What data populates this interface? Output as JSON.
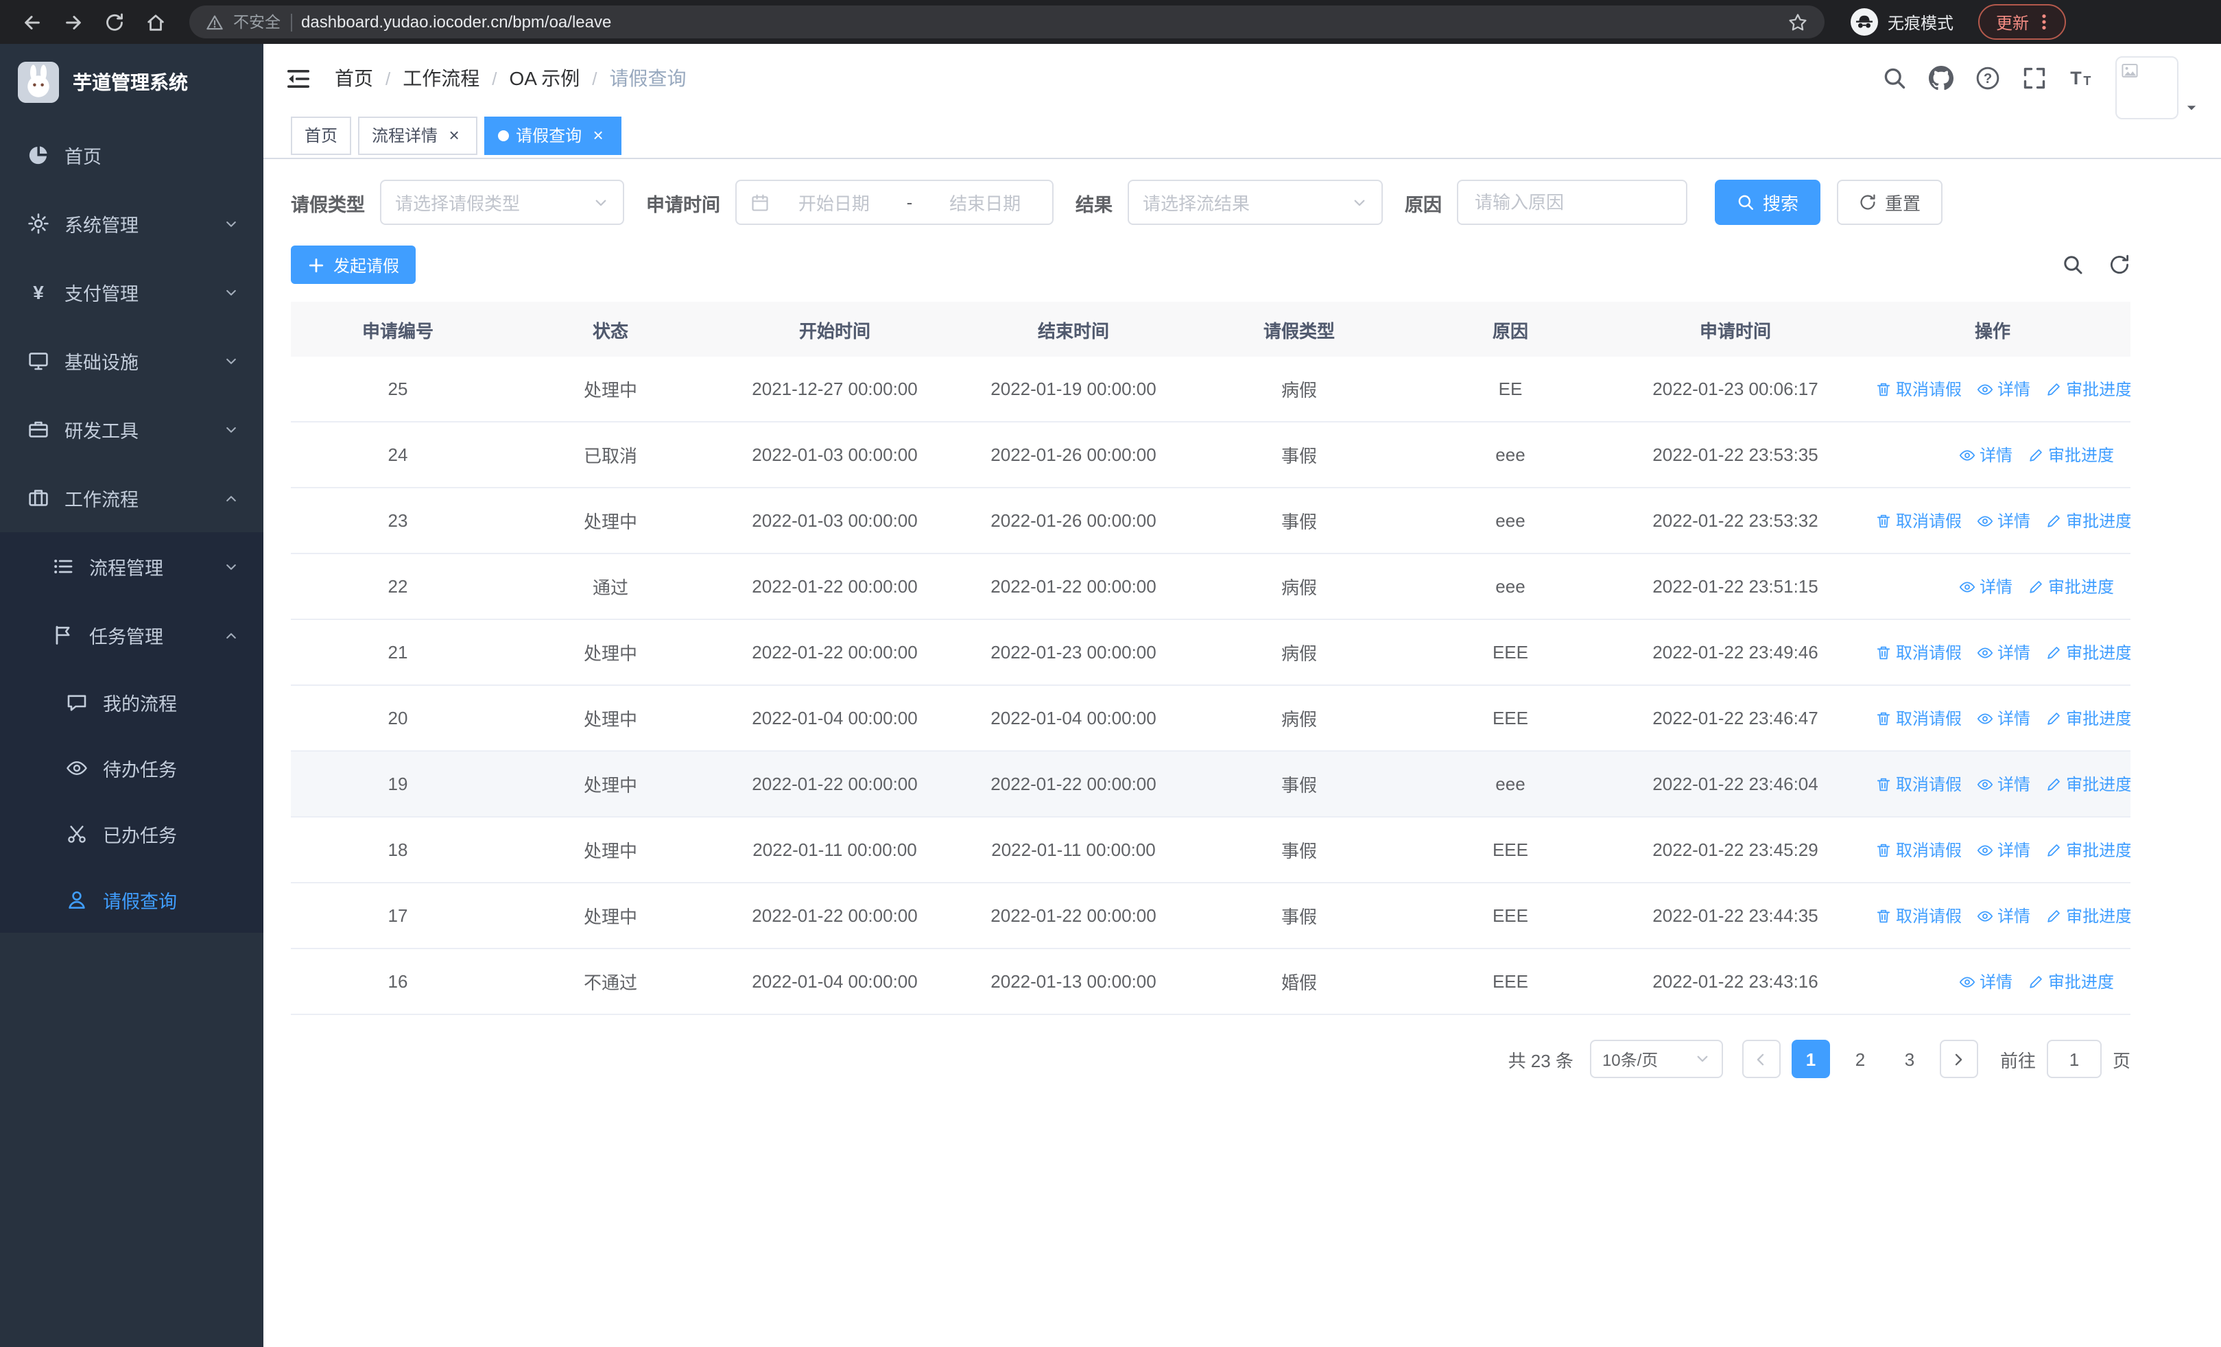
{
  "browser": {
    "security_warning": "不安全",
    "url": "dashboard.yudao.iocoder.cn/bpm/oa/leave",
    "incognito_label": "无痕模式",
    "update_label": "更新"
  },
  "sidebar": {
    "title": "芋道管理系统",
    "items": [
      {
        "key": "home",
        "label": "首页",
        "icon": "pie",
        "level": 1
      },
      {
        "key": "system",
        "label": "系统管理",
        "icon": "gear",
        "level": 1,
        "chevron": "down"
      },
      {
        "key": "payment",
        "label": "支付管理",
        "icon": "yen",
        "level": 1,
        "chevron": "down"
      },
      {
        "key": "infra",
        "label": "基础设施",
        "icon": "monitor",
        "level": 1,
        "chevron": "down"
      },
      {
        "key": "devtools",
        "label": "研发工具",
        "icon": "briefcase",
        "level": 1,
        "chevron": "down"
      },
      {
        "key": "workflow",
        "label": "工作流程",
        "icon": "suitcase",
        "level": 1,
        "chevron": "up"
      },
      {
        "key": "process",
        "label": "流程管理",
        "icon": "list",
        "level": 2,
        "chevron": "down"
      },
      {
        "key": "task",
        "label": "任务管理",
        "icon": "flag",
        "level": 2,
        "chevron": "up"
      },
      {
        "key": "my-process",
        "label": "我的流程",
        "icon": "chat",
        "level": 3
      },
      {
        "key": "todo",
        "label": "待办任务",
        "icon": "eye",
        "level": 3
      },
      {
        "key": "done",
        "label": "已办任务",
        "icon": "scissors",
        "level": 3
      },
      {
        "key": "leave",
        "label": "请假查询",
        "icon": "user",
        "level": 3,
        "active": true
      }
    ]
  },
  "header": {
    "breadcrumb": [
      "首页",
      "工作流程",
      "OA 示例",
      "请假查询"
    ]
  },
  "tabs": [
    {
      "label": "首页",
      "closable": false,
      "active": false
    },
    {
      "label": "流程详情",
      "closable": true,
      "active": false
    },
    {
      "label": "请假查询",
      "closable": true,
      "active": true
    }
  ],
  "filters": {
    "leave_type": {
      "label": "请假类型",
      "placeholder": "请选择请假类型"
    },
    "apply_time": {
      "label": "申请时间",
      "start_placeholder": "开始日期",
      "separator": "-",
      "end_placeholder": "结束日期"
    },
    "result": {
      "label": "结果",
      "placeholder": "请选择流结果"
    },
    "reason": {
      "label": "原因",
      "placeholder": "请输入原因"
    },
    "search_label": "搜索",
    "reset_label": "重置"
  },
  "toolbar": {
    "create_label": "发起请假"
  },
  "table": {
    "columns": [
      "申请编号",
      "状态",
      "开始时间",
      "结束时间",
      "请假类型",
      "原因",
      "申请时间",
      "操作"
    ],
    "action_labels": {
      "cancel": "取消请假",
      "detail": "详情",
      "progress": "审批进度"
    },
    "rows": [
      {
        "id": "25",
        "status": "处理中",
        "start": "2021-12-27 00:00:00",
        "end": "2022-01-19 00:00:00",
        "type": "病假",
        "reason": "EE",
        "applied": "2022-01-23 00:06:17",
        "actions": [
          "cancel",
          "detail",
          "progress"
        ]
      },
      {
        "id": "24",
        "status": "已取消",
        "start": "2022-01-03 00:00:00",
        "end": "2022-01-26 00:00:00",
        "type": "事假",
        "reason": "eee",
        "applied": "2022-01-22 23:53:35",
        "actions": [
          "detail",
          "progress"
        ]
      },
      {
        "id": "23",
        "status": "处理中",
        "start": "2022-01-03 00:00:00",
        "end": "2022-01-26 00:00:00",
        "type": "事假",
        "reason": "eee",
        "applied": "2022-01-22 23:53:32",
        "actions": [
          "cancel",
          "detail",
          "progress"
        ]
      },
      {
        "id": "22",
        "status": "通过",
        "start": "2022-01-22 00:00:00",
        "end": "2022-01-22 00:00:00",
        "type": "病假",
        "reason": "eee",
        "applied": "2022-01-22 23:51:15",
        "actions": [
          "detail",
          "progress"
        ]
      },
      {
        "id": "21",
        "status": "处理中",
        "start": "2022-01-22 00:00:00",
        "end": "2022-01-23 00:00:00",
        "type": "病假",
        "reason": "EEE",
        "applied": "2022-01-22 23:49:46",
        "actions": [
          "cancel",
          "detail",
          "progress"
        ]
      },
      {
        "id": "20",
        "status": "处理中",
        "start": "2022-01-04 00:00:00",
        "end": "2022-01-04 00:00:00",
        "type": "病假",
        "reason": "EEE",
        "applied": "2022-01-22 23:46:47",
        "actions": [
          "cancel",
          "detail",
          "progress"
        ]
      },
      {
        "id": "19",
        "status": "处理中",
        "start": "2022-01-22 00:00:00",
        "end": "2022-01-22 00:00:00",
        "type": "事假",
        "reason": "eee",
        "applied": "2022-01-22 23:46:04",
        "actions": [
          "cancel",
          "detail",
          "progress"
        ],
        "hovered": true
      },
      {
        "id": "18",
        "status": "处理中",
        "start": "2022-01-11 00:00:00",
        "end": "2022-01-11 00:00:00",
        "type": "事假",
        "reason": "EEE",
        "applied": "2022-01-22 23:45:29",
        "actions": [
          "cancel",
          "detail",
          "progress"
        ]
      },
      {
        "id": "17",
        "status": "处理中",
        "start": "2022-01-22 00:00:00",
        "end": "2022-01-22 00:00:00",
        "type": "事假",
        "reason": "EEE",
        "applied": "2022-01-22 23:44:35",
        "actions": [
          "cancel",
          "detail",
          "progress"
        ]
      },
      {
        "id": "16",
        "status": "不通过",
        "start": "2022-01-04 00:00:00",
        "end": "2022-01-13 00:00:00",
        "type": "婚假",
        "reason": "EEE",
        "applied": "2022-01-22 23:43:16",
        "actions": [
          "detail",
          "progress"
        ]
      }
    ]
  },
  "pagination": {
    "total_label": "共 23 条",
    "page_size": "10条/页",
    "pages": [
      "1",
      "2",
      "3"
    ],
    "active_page": "1",
    "goto_label": "前往",
    "goto_value": "1",
    "goto_suffix": "页"
  },
  "colors": {
    "primary": "#409eff",
    "sidebar_bg": "#28323f",
    "table_header_bg": "#f8f8f9"
  }
}
